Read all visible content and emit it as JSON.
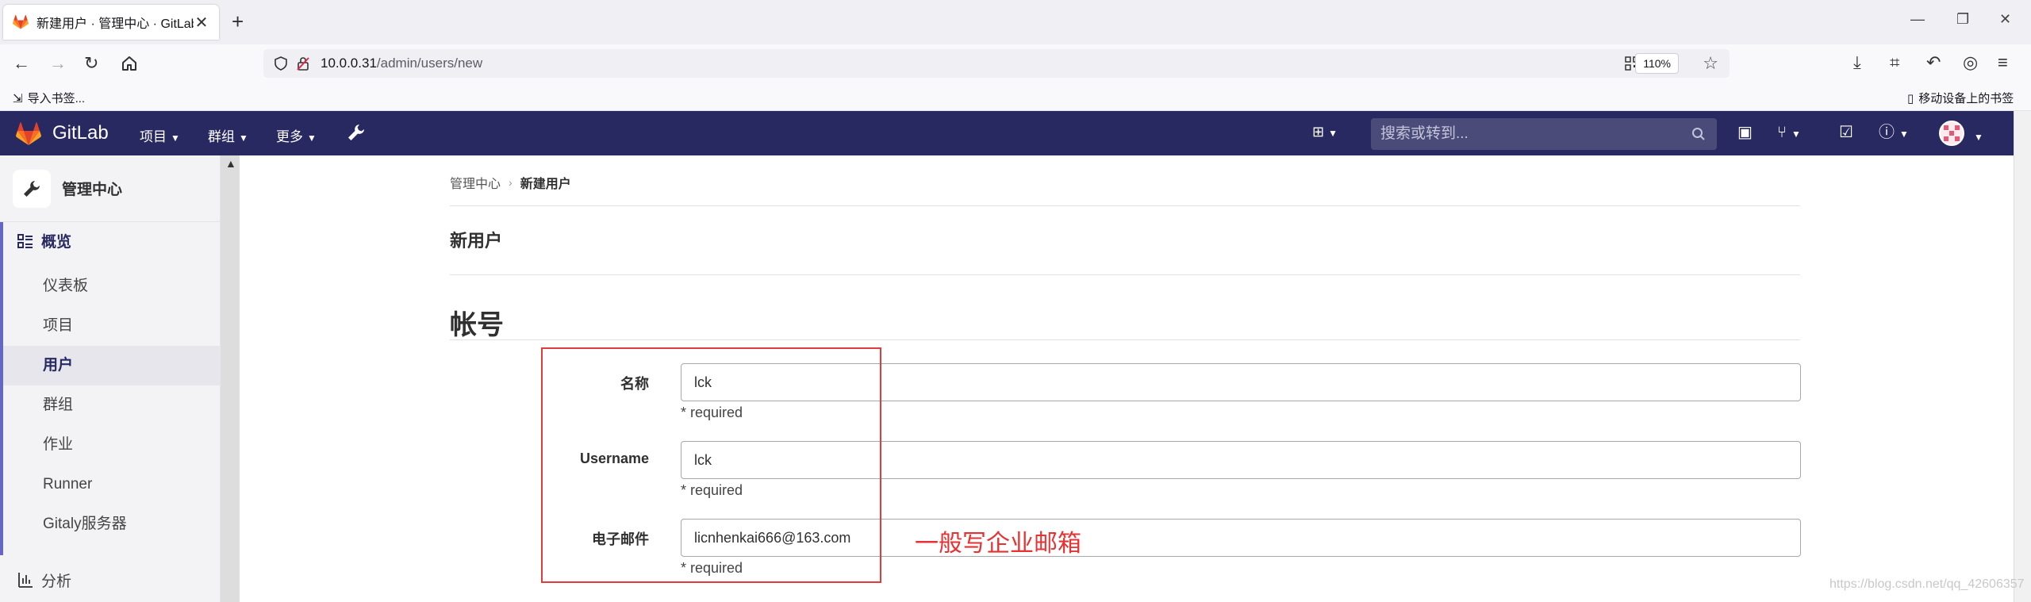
{
  "browser": {
    "tab_title": "新建用户 · 管理中心 · GitLab",
    "url_host": "10.0.0.31",
    "url_path": "/admin/users/new",
    "zoom": "110%",
    "bookmarks_left": "导入书签...",
    "bookmarks_right": "移动设备上的书签"
  },
  "gitlab_header": {
    "brand": "GitLab",
    "menu_projects": "项目",
    "menu_groups": "群组",
    "menu_more": "更多",
    "search_placeholder": "搜索或转到..."
  },
  "sidebar": {
    "context_title": "管理中心",
    "overview_label": "概览",
    "items": [
      {
        "label": "仪表板",
        "active": false
      },
      {
        "label": "项目",
        "active": false
      },
      {
        "label": "用户",
        "active": true
      },
      {
        "label": "群组",
        "active": false
      },
      {
        "label": "作业",
        "active": false
      },
      {
        "label": "Runner",
        "active": false
      },
      {
        "label": "Gitaly服务器",
        "active": false
      }
    ],
    "analytics_label": "分析"
  },
  "main": {
    "breadcrumb_root": "管理中心",
    "breadcrumb_current": "新建用户",
    "page_title": "新用户",
    "section_title": "帐号",
    "fields": [
      {
        "label": "名称",
        "value": "lck",
        "help": "* required"
      },
      {
        "label": "Username",
        "value": "lck",
        "help": "* required"
      },
      {
        "label": "电子邮件",
        "value": "licnhenkai666@163.com",
        "help": "* required"
      }
    ]
  },
  "annotation": {
    "text": "一般写企业邮箱",
    "color": "#e63232"
  },
  "watermark": "https://blog.csdn.net/qq_42606357",
  "colors": {
    "gitlab_header": "#292961",
    "accent": "#6666c4",
    "annotation_red": "#e03c3c"
  }
}
